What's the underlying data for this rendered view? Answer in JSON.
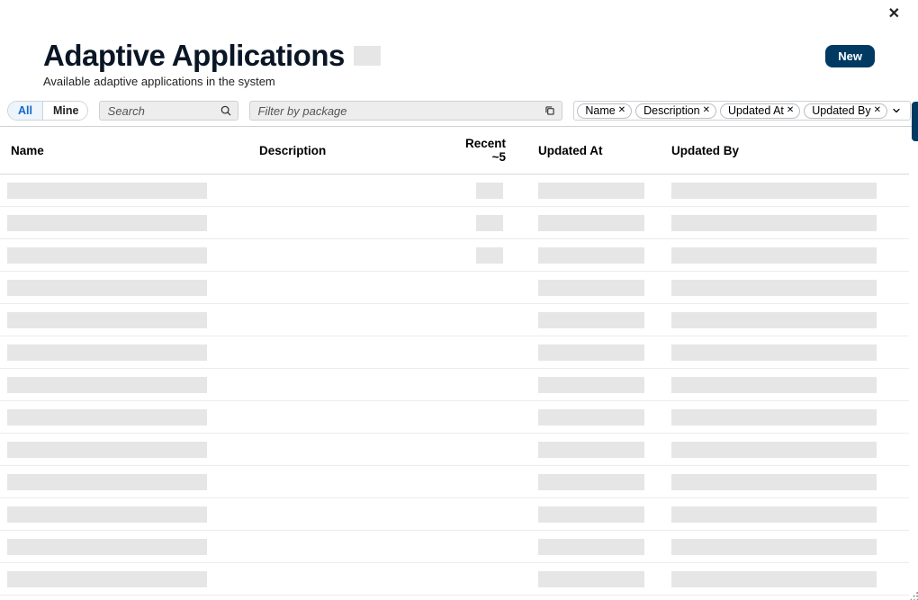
{
  "close_label": "✕",
  "header": {
    "title": "Adaptive Applications",
    "subtitle": "Available adaptive applications in the system",
    "new_button": "New"
  },
  "filters": {
    "segmented": {
      "all": "All",
      "mine": "Mine",
      "active": "all"
    },
    "search_placeholder": "Search",
    "package_placeholder": "Filter by package",
    "chips": [
      "Name",
      "Description",
      "Updated At",
      "Updated By"
    ]
  },
  "columns": {
    "name": "Name",
    "description": "Description",
    "recent": "Recent ~5",
    "updated_at": "Updated At",
    "updated_by": "Updated By"
  },
  "rows": [
    {
      "has_recent": true
    },
    {
      "has_recent": true
    },
    {
      "has_recent": true
    },
    {
      "has_recent": false
    },
    {
      "has_recent": false
    },
    {
      "has_recent": false
    },
    {
      "has_recent": false
    },
    {
      "has_recent": false
    },
    {
      "has_recent": false
    },
    {
      "has_recent": false
    },
    {
      "has_recent": false
    },
    {
      "has_recent": false
    },
    {
      "has_recent": false
    }
  ]
}
